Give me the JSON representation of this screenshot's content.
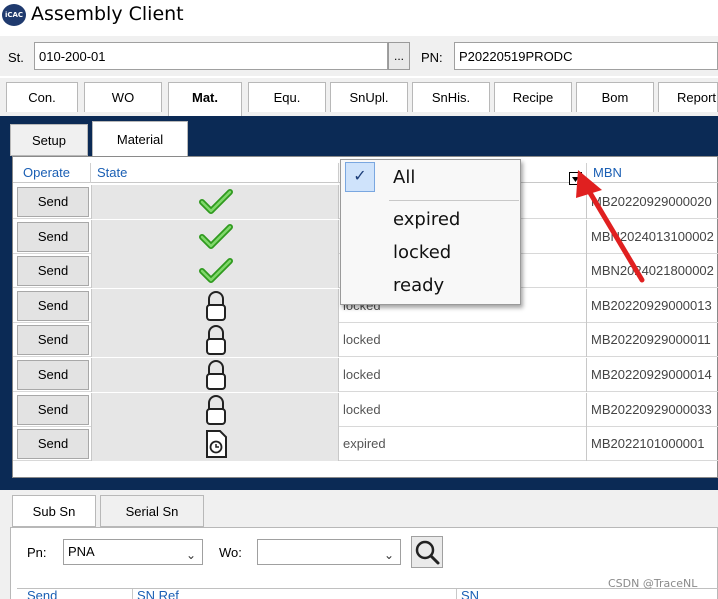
{
  "app": {
    "title": "Assembly Client",
    "logo_text": "iCAC"
  },
  "station": {
    "st_label": "St.",
    "st_value": "010-200-01",
    "browse_label": "...",
    "pn_label": "PN:",
    "pn_value": "P20220519PRODC"
  },
  "main_tabs": [
    {
      "label": "Con."
    },
    {
      "label": "WO"
    },
    {
      "label": "Mat."
    },
    {
      "label": "Equ."
    },
    {
      "label": "SnUpl."
    },
    {
      "label": "SnHis."
    },
    {
      "label": "Recipe"
    },
    {
      "label": "Bom"
    },
    {
      "label": "Report"
    }
  ],
  "sub_tabs": [
    {
      "label": "Setup"
    },
    {
      "label": "Material"
    }
  ],
  "grid": {
    "headers": {
      "operate": "Operate",
      "state": "State",
      "mbn": "MBN"
    },
    "rows": [
      {
        "send": "Send",
        "icon": "check-icon",
        "status": "",
        "mbn": "MB20220929000020"
      },
      {
        "send": "Send",
        "icon": "check-icon",
        "status": "",
        "mbn": "MBN2024013100002"
      },
      {
        "send": "Send",
        "icon": "check-icon",
        "status": "",
        "mbn": "MBN2024021800002"
      },
      {
        "send": "Send",
        "icon": "lock-icon",
        "status": "locked",
        "mbn": "MB20220929000013"
      },
      {
        "send": "Send",
        "icon": "lock-icon",
        "status": "locked",
        "mbn": "MB20220929000011"
      },
      {
        "send": "Send",
        "icon": "lock-icon",
        "status": "locked",
        "mbn": "MB20220929000014"
      },
      {
        "send": "Send",
        "icon": "lock-icon",
        "status": "locked",
        "mbn": "MB20220929000033"
      },
      {
        "send": "Send",
        "icon": "expired-doc-icon",
        "status": "expired",
        "mbn": "MB2022101000001"
      }
    ]
  },
  "filter_dropdown": {
    "items": [
      {
        "label": "All",
        "checked": true
      },
      {
        "label": "expired"
      },
      {
        "label": "locked"
      },
      {
        "label": "ready"
      }
    ]
  },
  "bottom": {
    "tabs": [
      {
        "label": "Sub Sn"
      },
      {
        "label": "Serial Sn"
      }
    ],
    "pn_label": "Pn:",
    "pn_value": "PNA",
    "wo_label": "Wo:",
    "wo_value": "",
    "headers": {
      "send": "Send",
      "sn_ref": "SN Ref",
      "sn": "SN"
    }
  },
  "watermark": "CSDN @TraceNL",
  "colors": {
    "dark_panel": "#0b2a55",
    "header_text": "#1a5fb4",
    "arrow": "#e02020",
    "check_green": "#3fae2a"
  }
}
